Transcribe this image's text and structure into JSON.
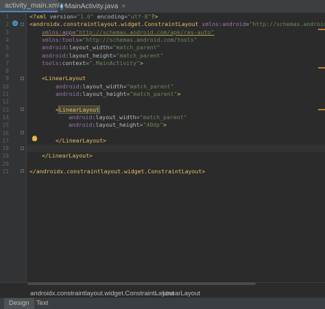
{
  "tabs": [
    {
      "label": "activity_main.xml",
      "icon": "xml-file-icon",
      "active": true
    },
    {
      "label": "MainActivity.java",
      "icon": "java-class-icon",
      "active": false
    }
  ],
  "line_numbers": [
    "1",
    "2",
    "3",
    "4",
    "5",
    "6",
    "7",
    "8",
    "9",
    "10",
    "11",
    "12",
    "13",
    "14",
    "15",
    "16",
    "17",
    "18",
    "19",
    "20",
    "21"
  ],
  "code": {
    "l1": {
      "open": "<?xml ",
      "a1": "version",
      "eq1": "=",
      "v1": "\"1.0\"",
      "sp": " ",
      "a2": "encoding",
      "eq2": "=",
      "v2": "\"utf-8\"",
      "close": "?>"
    },
    "l2": {
      "tag": "<androidx.constraintlayout.widget.ConstraintLayout",
      "ns": "xmlns:android",
      "eq": "=",
      "val": "\"http://schemas.android.c"
    },
    "l3": {
      "ns": "xmlns:app",
      "eq": "=",
      "val": "\"http://schemas.android.com/apk/res-auto\""
    },
    "l4": {
      "ns": "xmlns:tools",
      "eq": "=",
      "val": "\"http://schemas.android.com/tools\""
    },
    "l5": {
      "ns": "android",
      "a": ":layout_width",
      "eq": "=",
      "val": "\"match_parent\""
    },
    "l6": {
      "ns": "android",
      "a": ":layout_height",
      "eq": "=",
      "val": "\"match_parent\""
    },
    "l7": {
      "ns": "tools",
      "a": ":context",
      "eq": "=",
      "val": "\".MainActivity\"",
      "close": ">"
    },
    "l9": {
      "tag": "<LinearLayout"
    },
    "l10": {
      "ns": "android",
      "a": ":layout_width",
      "eq": "=",
      "val": "\"match_parent\""
    },
    "l11": {
      "ns": "android",
      "a": ":layout_height",
      "eq": "=",
      "val": "\"match_parent\"",
      "close": ">"
    },
    "l13": {
      "lt": "<",
      "tag": "LinearLayout"
    },
    "l14": {
      "ns": "android",
      "a": ":layout_width",
      "eq": "=",
      "val": "\"match_parent\""
    },
    "l15": {
      "ns": "android",
      "a": ":layout_height",
      "eq": "=",
      "val": "\"40dp\"",
      "close": ">"
    },
    "l16": {
      "tag": "</LinearLayout>"
    },
    "l18": {
      "tag": "</LinearLayout>"
    },
    "l21": {
      "tag": "</androidx.constraintlayout.widget.ConstraintLayout>"
    }
  },
  "breadcrumb": [
    "androidx.constraintlayout.widget.ConstraintLayout",
    "LinearLayout"
  ],
  "bottom_tabs": [
    {
      "label": "Design",
      "active": true
    },
    {
      "label": "Text",
      "active": false
    }
  ],
  "colors": {
    "editor_bg": "#2b2b2b",
    "tag": "#e8bf6a",
    "namespace": "#9876aa",
    "string": "#6a8759",
    "line_number": "#606366"
  }
}
